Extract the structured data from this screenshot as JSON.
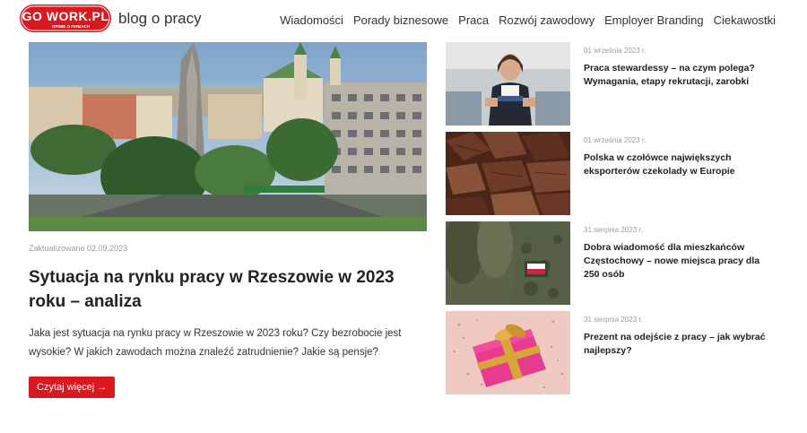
{
  "header": {
    "logo_text": "GO WORK.PL",
    "logo_subtext": "OPINIE O FIRMACH",
    "blog_title": "blog o pracy",
    "nav": [
      {
        "label": "Wiadomości"
      },
      {
        "label": "Porady biznesowe"
      },
      {
        "label": "Praca"
      },
      {
        "label": "Rozwój zawodowy"
      },
      {
        "label": "Employer Branding"
      },
      {
        "label": "Ciekawostki"
      }
    ]
  },
  "main": {
    "date": "Zaktualizowano 02.09.2023",
    "title": "Sytuacja na rynku pracy w Rzeszowie w 2023 roku – analiza",
    "excerpt": "Jaka jest sytuacja na rynku pracy w Rzeszowie w 2023 roku? Czy bezrobocie jest wysokie? W jakich zawodach można znaleźć zatrudnienie? Jakie są pensje?",
    "read_more": "Czytaj więcej →",
    "image": "city-photo"
  },
  "side": [
    {
      "date": "01 września 2023 r.",
      "title": "Praca stewardessy – na czym polega? Wymagania, etapy rekrutacji, zarobki",
      "image": "stewardess-photo"
    },
    {
      "date": "01 września 2023 r.",
      "title": "Polska w czołówce największych eksporterów czekolady w Europie",
      "image": "chocolate-photo"
    },
    {
      "date": "31 sierpnia 2023 r.",
      "title": "Dobra wiadomość dla mieszkańców Częstochowy – nowe miejsca pracy dla 250 osób",
      "image": "soldiers-photo"
    },
    {
      "date": "31 sierpnia 2023 r.",
      "title": "Prezent na odejście z pracy – jak wybrać najlepszy?",
      "image": "gift-photo"
    }
  ],
  "colors": {
    "brand_red": "#d9181f",
    "text": "#222222",
    "muted": "#9a9a9a"
  }
}
